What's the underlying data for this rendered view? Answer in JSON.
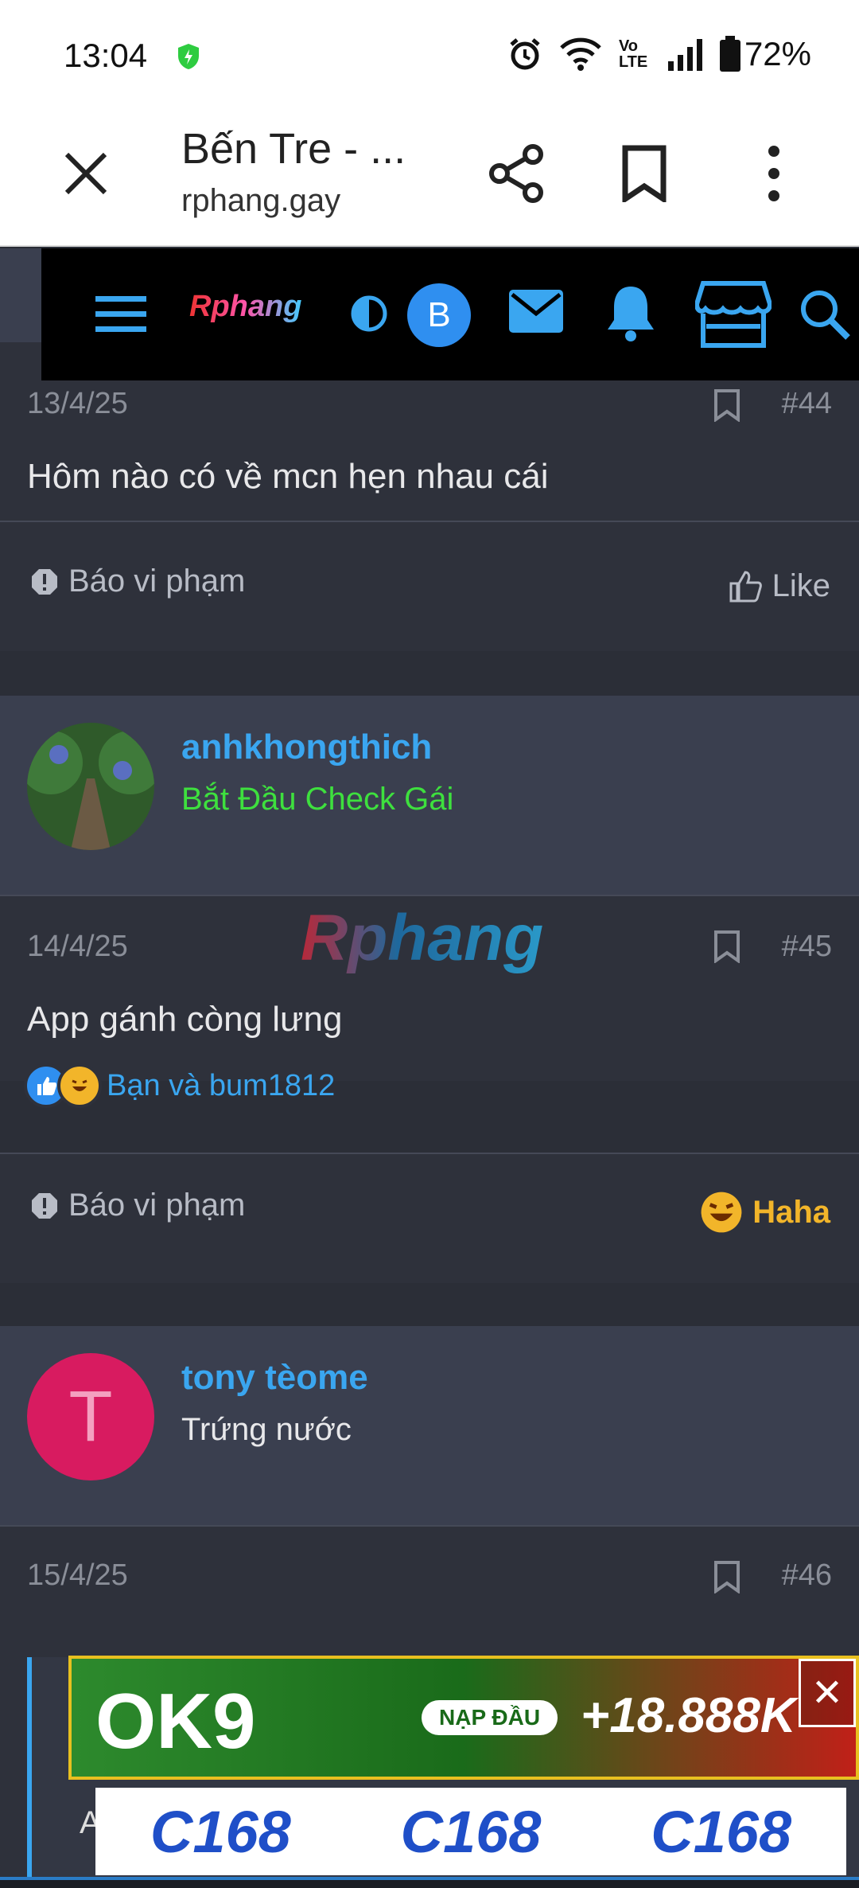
{
  "status_bar": {
    "time": "13:04",
    "battery": "72%",
    "volte": "Vo LTE"
  },
  "browser": {
    "title": "Bến Tre - ...",
    "url": "rphang.gay"
  },
  "site_nav": {
    "logo": "Rphang",
    "avatar_letter": "B"
  },
  "watermark": "Rphang",
  "posts": [
    {
      "date": "13/4/25",
      "number": "#44",
      "body": "Hôm nào có về mcn hẹn nhau cái",
      "report": "Báo vi phạm",
      "action": "Like"
    },
    {
      "user": {
        "name": "anhkhongthich",
        "title": "Bắt Đầu Check Gái",
        "title_color": "#3ee03e"
      },
      "date": "14/4/25",
      "number": "#45",
      "body": "App gánh còng lưng",
      "reactions_text": "Bạn và bum1812",
      "report": "Báo vi phạm",
      "action": "Haha"
    },
    {
      "user": {
        "name": "tony tèome",
        "title": "Trứng nước",
        "title_color": "#e8e8ea",
        "avatar_letter": "T",
        "avatar_color": "#d81b60"
      },
      "date": "15/4/25",
      "number": "#46",
      "quote_start": "A"
    }
  ],
  "ads": {
    "banner1": {
      "brand": "OK9",
      "button": "NẠP ĐẦU",
      "amount": "+18.888K"
    },
    "banner2": {
      "items": [
        "C168",
        "C168",
        "C168"
      ]
    }
  }
}
